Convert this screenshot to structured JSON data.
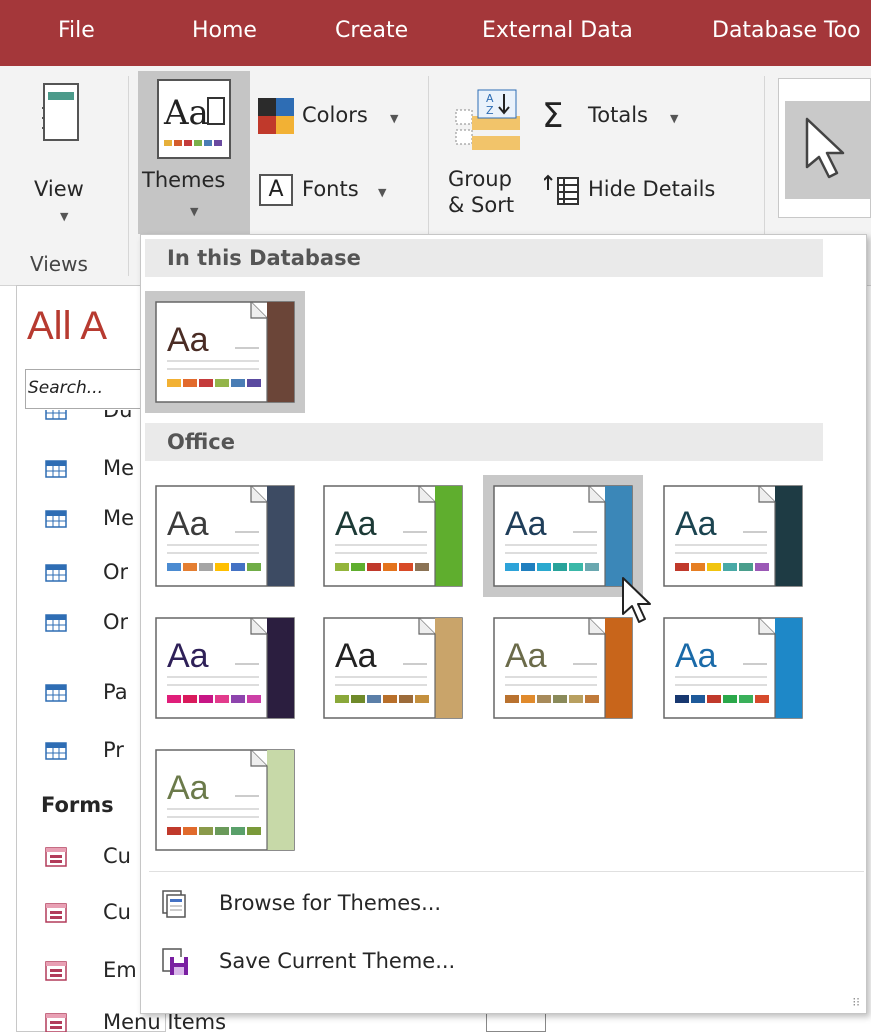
{
  "tabs": [
    "File",
    "Home",
    "Create",
    "External Data",
    "Database Too"
  ],
  "ribbon": {
    "view_label": "View",
    "themes_label": "Themes",
    "colors_label": "Colors",
    "fonts_label": "Fonts",
    "group_sort_line1": "Group",
    "group_sort_line2": "& Sort",
    "totals_label": "Totals",
    "hide_details_label": "Hide Details",
    "views_group_label": "Views"
  },
  "nav": {
    "title": "All A",
    "search_placeholder": "Search...",
    "items": [
      "Du",
      "Me",
      "Me",
      "Or",
      "Or",
      "Pa",
      "Pr"
    ],
    "forms_header": "Forms",
    "form_items": [
      "Cu",
      "Cu",
      "Em",
      "Menu Items"
    ]
  },
  "dropdown": {
    "section_database": "In this Database",
    "section_office": "Office",
    "browse_label": "Browse for Themes...",
    "save_label": "Save Current Theme...",
    "db_theme": {
      "glyph": "Aa",
      "text_color": "#4a2c24",
      "accent": "#6b4538",
      "swatches": [
        "#f2b134",
        "#e26a2c",
        "#c43b3b",
        "#93b54a",
        "#4a7db5",
        "#5a4aa0"
      ]
    },
    "office_themes": [
      {
        "glyph": "Aa",
        "text_color": "#3c3c3c",
        "accent": "#3d4b63",
        "swatches": [
          "#4b8bd1",
          "#e47e31",
          "#a5a5a5",
          "#ffbf00",
          "#4472c4",
          "#70ad47"
        ],
        "selected": false
      },
      {
        "glyph": "Aa",
        "text_color": "#1c3a36",
        "accent": "#5fae2e",
        "swatches": [
          "#93b53b",
          "#5fae2e",
          "#c0392b",
          "#e4731c",
          "#d84a27",
          "#8b7355"
        ],
        "selected": false
      },
      {
        "glyph": "Aa",
        "text_color": "#1f3e5a",
        "accent": "#3b87b8",
        "swatches": [
          "#2da3d9",
          "#1f7fbf",
          "#2aa9cf",
          "#28a39b",
          "#3ab8a8",
          "#6aa8b0"
        ],
        "selected": true
      },
      {
        "glyph": "Aa",
        "text_color": "#1b4450",
        "accent": "#1e3b44",
        "swatches": [
          "#c0392b",
          "#e67e22",
          "#f1c40f",
          "#48a9a6",
          "#4a9e8c",
          "#9b59b6"
        ],
        "selected": false
      },
      {
        "glyph": "Aa",
        "text_color": "#2e2058",
        "accent": "#2b1e3f",
        "swatches": [
          "#e01e7a",
          "#d91a5c",
          "#c71585",
          "#e23b8c",
          "#8e44ad",
          "#cc3fa6"
        ],
        "selected": false
      },
      {
        "glyph": "Aa",
        "text_color": "#222",
        "accent": "#c9a46a",
        "swatches": [
          "#8aa83a",
          "#6f8a2a",
          "#5b7fa8",
          "#b86f2a",
          "#9c6b3a",
          "#c4903e"
        ],
        "selected": false
      },
      {
        "glyph": "Aa",
        "text_color": "#6b6b4a",
        "accent": "#c8651b",
        "swatches": [
          "#b9722f",
          "#e08a2c",
          "#a78a5a",
          "#8a8a5a",
          "#b8a060",
          "#c07a3a"
        ],
        "selected": false
      },
      {
        "glyph": "Aa",
        "text_color": "#1a6aa8",
        "accent": "#1e88c8",
        "swatches": [
          "#183870",
          "#1e5a9a",
          "#c0392b",
          "#2aa84a",
          "#3ab05a",
          "#d64a2c"
        ],
        "selected": false
      },
      {
        "glyph": "Aa",
        "text_color": "#6b7a4a",
        "accent": "#c7d9a8",
        "swatches": [
          "#c0392b",
          "#e06a2c",
          "#8a9a4a",
          "#6a9a5a",
          "#5aa06a",
          "#7a9a3a"
        ],
        "selected": false
      }
    ]
  }
}
